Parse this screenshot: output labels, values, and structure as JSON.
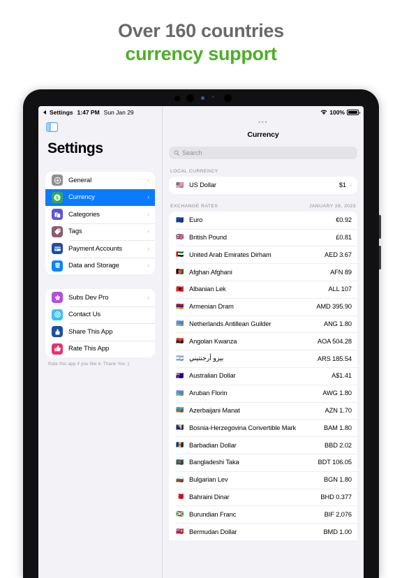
{
  "headline": {
    "line1": "Over 160 countries",
    "line2": "currency support",
    "color_gray": "#696969",
    "color_green": "#4caf27"
  },
  "statusbar": {
    "back_label": "Settings",
    "time": "1:47 PM",
    "date": "Sun Jan 29",
    "battery_percent": "100%"
  },
  "sidebar": {
    "title": "Settings",
    "footnote": "Rate this app if you like it. Thank You :)",
    "group1": [
      {
        "label": "General",
        "icon": "gear-icon",
        "color": "#8e8e93",
        "selected": false,
        "chevron": "›"
      },
      {
        "label": "Currency",
        "icon": "dollar-circle-icon",
        "color": "#34a853",
        "selected": true,
        "chevron": "›"
      },
      {
        "label": "Categories",
        "icon": "categories-icon",
        "color": "#5b54d6",
        "selected": false,
        "chevron": "›"
      },
      {
        "label": "Tags",
        "icon": "tag-icon",
        "color": "#8e5b6e",
        "selected": false,
        "chevron": "›"
      },
      {
        "label": "Payment Accounts",
        "icon": "credit-card-icon",
        "color": "#1b4fa0",
        "selected": false,
        "chevron": "›"
      },
      {
        "label": "Data and Storage",
        "icon": "database-icon",
        "color": "#0a84ff",
        "selected": false,
        "chevron": "›"
      }
    ],
    "group2": [
      {
        "label": "Subs Dev Pro",
        "icon": "star-icon",
        "color": "#b44de0",
        "chevron": "›"
      },
      {
        "label": "Contact Us",
        "icon": "mail-icon",
        "color": "#3dc0f5",
        "chevron": ""
      },
      {
        "label": "Share This App",
        "icon": "share-icon",
        "color": "#1b4fa0",
        "chevron": ""
      },
      {
        "label": "Rate This App",
        "icon": "thumbs-up-icon",
        "color": "#e8336d",
        "chevron": ""
      }
    ]
  },
  "detail": {
    "title": "Currency",
    "search_placeholder": "Search",
    "local_section_label": "LOCAL CURRENCY",
    "local_currency": {
      "flag": "🇺🇸",
      "name": "US Dollar",
      "value": "$1",
      "chevron": "›"
    },
    "rates_section_label": "EXCHANGE RATES",
    "rates_date": "JANUARY 28, 2023",
    "rates": [
      {
        "flag": "🇪🇺",
        "name": "Euro",
        "value": "€0.92"
      },
      {
        "flag": "🇬🇧",
        "name": "British Pound",
        "value": "£0.81"
      },
      {
        "flag": "🇦🇪",
        "name": "United Arab Emirates Dirham",
        "value": "AED 3.67"
      },
      {
        "flag": "🇦🇫",
        "name": "Afghan Afghani",
        "value": "AFN 89"
      },
      {
        "flag": "🇦🇱",
        "name": "Albanian Lek",
        "value": "ALL 107"
      },
      {
        "flag": "🇦🇲",
        "name": "Armenian Dram",
        "value": "AMD 395.90"
      },
      {
        "flag": "🇦🇼",
        "name": "Netherlands Antillean Guilder",
        "value": "ANG 1.80"
      },
      {
        "flag": "🇦🇴",
        "name": "Angolan Kwanza",
        "value": "AOA 504.28"
      },
      {
        "flag": "🇦🇷",
        "name": "بيزو أرجنتيني",
        "value": "ARS 185.54",
        "rtl": true
      },
      {
        "flag": "🇦🇺",
        "name": "Australian Dollar",
        "value": "A$1.41"
      },
      {
        "flag": "🇦🇼",
        "name": "Aruban Florin",
        "value": "AWG 1.80"
      },
      {
        "flag": "🇦🇿",
        "name": "Azerbaijani Manat",
        "value": "AZN 1.70"
      },
      {
        "flag": "🇧🇦",
        "name": "Bosnia-Herzegovina Convertible Mark",
        "value": "BAM 1.80"
      },
      {
        "flag": "🇧🇧",
        "name": "Barbadian Dollar",
        "value": "BBD 2.02"
      },
      {
        "flag": "🇧🇩",
        "name": "Bangladeshi Taka",
        "value": "BDT 106.05"
      },
      {
        "flag": "🇧🇬",
        "name": "Bulgarian Lev",
        "value": "BGN 1.80"
      },
      {
        "flag": "🇧🇭",
        "name": "Bahraini Dinar",
        "value": "BHD 0.377"
      },
      {
        "flag": "🇧🇮",
        "name": "Burundian Franc",
        "value": "BIF 2,076"
      },
      {
        "flag": "🇧🇲",
        "name": "Bermudan Dollar",
        "value": "BMD 1.00"
      }
    ]
  }
}
